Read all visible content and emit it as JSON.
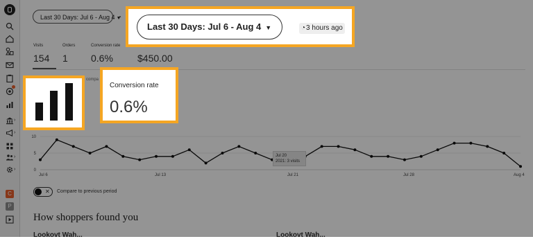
{
  "header": {
    "date_range_small": "Last 30 Days: Jul 6 - Aug 4",
    "date_range_large": "Last 30 Days: Jul 6 - Aug 4",
    "updated_ago": "3 hours ago"
  },
  "stats": {
    "visits_label": "Visits",
    "visits_value": "154",
    "orders_label": "Orders",
    "orders_value": "1",
    "conversion_label": "Conversion rate",
    "conversion_value": "0.6%",
    "revenue_value": "$450.00"
  },
  "compare_snippet": "compa",
  "callout_rate": {
    "label": "Conversion rate",
    "value": "0.6%"
  },
  "tooltip": {
    "date": "Jul 20",
    "line2": "2021: 3 visits"
  },
  "chart_data": {
    "type": "line",
    "x_ticks": [
      "Jul 6",
      "Jul 13",
      "Jul 21",
      "Jul 28",
      "Aug 4"
    ],
    "y_ticks": [
      "10",
      "5",
      "0"
    ],
    "ylim": [
      0,
      10
    ],
    "grid": true,
    "series": [
      {
        "values": [
          3,
          9,
          7,
          5,
          7,
          4,
          3,
          4,
          4,
          6,
          2,
          5,
          7,
          5,
          3,
          4,
          4,
          7,
          7,
          6,
          4,
          4,
          3,
          4,
          6,
          8,
          8,
          7,
          5,
          1
        ]
      }
    ]
  },
  "compare_toggle": {
    "label": "Compare to previous period",
    "off_symbol": "✕"
  },
  "section": {
    "title": "How shoppers found you",
    "cut_left": "Lookovt Wah...",
    "cut_right": "Lookovt Wah..."
  },
  "sidebar": {
    "badge_c": "C",
    "badge_p": "P"
  },
  "icons": {
    "callout_chart": "bar-chart-icon",
    "clock": "clock-icon"
  },
  "colors": {
    "callout_border": "#f5a623",
    "alert_dot": "#e8602c"
  }
}
